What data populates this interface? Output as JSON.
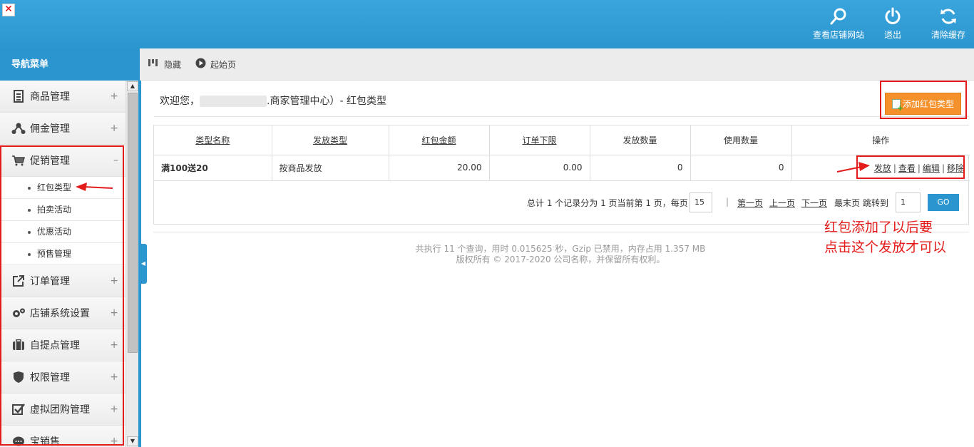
{
  "header": {
    "actions": [
      {
        "label": "查看店铺网站",
        "icon": "search-icon"
      },
      {
        "label": "退出",
        "icon": "power-icon"
      },
      {
        "label": "清除缓存",
        "icon": "refresh-icon"
      }
    ]
  },
  "nav": {
    "title": "导航菜单",
    "items": [
      {
        "label": "商品管理",
        "icon": "document-icon",
        "toggle": "+"
      },
      {
        "label": "佣金管理",
        "icon": "share-icon",
        "toggle": "+"
      },
      {
        "label": "促销管理",
        "icon": "cart-icon",
        "toggle": "–"
      },
      {
        "label": "订单管理",
        "icon": "external-link-icon",
        "toggle": "+"
      },
      {
        "label": "店铺系统设置",
        "icon": "gears-icon",
        "toggle": "+"
      },
      {
        "label": "自提点管理",
        "icon": "suitcase-icon",
        "toggle": "+"
      },
      {
        "label": "权限管理",
        "icon": "shield-icon",
        "toggle": "+"
      },
      {
        "label": "虚拟团购管理",
        "icon": "checkbox-icon",
        "toggle": "+"
      },
      {
        "label": "宝销售",
        "icon": "chat-icon",
        "toggle": "+"
      }
    ],
    "subitems": [
      "红包类型",
      "拍卖活动",
      "优惠活动",
      "预售管理"
    ]
  },
  "toolbar": {
    "hide_label": "隐藏",
    "home_label": "起始页"
  },
  "main": {
    "welcome_prefix": "欢迎您，",
    "welcome_suffix": ".商家管理中心）- 红包类型",
    "add_button": "添加红包类型",
    "table": {
      "headers": [
        "类型名称",
        "发放类型",
        "红包金额",
        "订单下限",
        "发放数量",
        "使用数量",
        "操作"
      ],
      "rows": [
        {
          "name": "满100送20",
          "send_type": "按商品发放",
          "amount": "20.00",
          "min_order": "0.00",
          "issued": "0",
          "used": "0"
        }
      ],
      "ops": [
        "发放",
        "查看",
        "编辑",
        "移除"
      ],
      "sep": "|"
    },
    "pager": {
      "summary": "总计 1 个记录分为 1 页当前第 1 页，每页",
      "per_page": "15",
      "first": "第一页",
      "prev": "上一页",
      "next": "下一页",
      "last": "最末页",
      "jump_label": "跳转到",
      "jump_value": "1",
      "go": "GO"
    },
    "footer_line1": "共执行 11 个查询，用时 0.015625 秒，Gzip 已禁用，内存占用 1.357 MB",
    "footer_line2": "版权所有 © 2017-2020 公司名称，并保留所有权利。"
  },
  "annotation": {
    "line1": "红包添加了以后要",
    "line2": "点击这个发放才可以",
    "color": "#e31b1b"
  },
  "colors": {
    "header_blue": "#2b95cf",
    "orange_button": "#f4912b"
  }
}
